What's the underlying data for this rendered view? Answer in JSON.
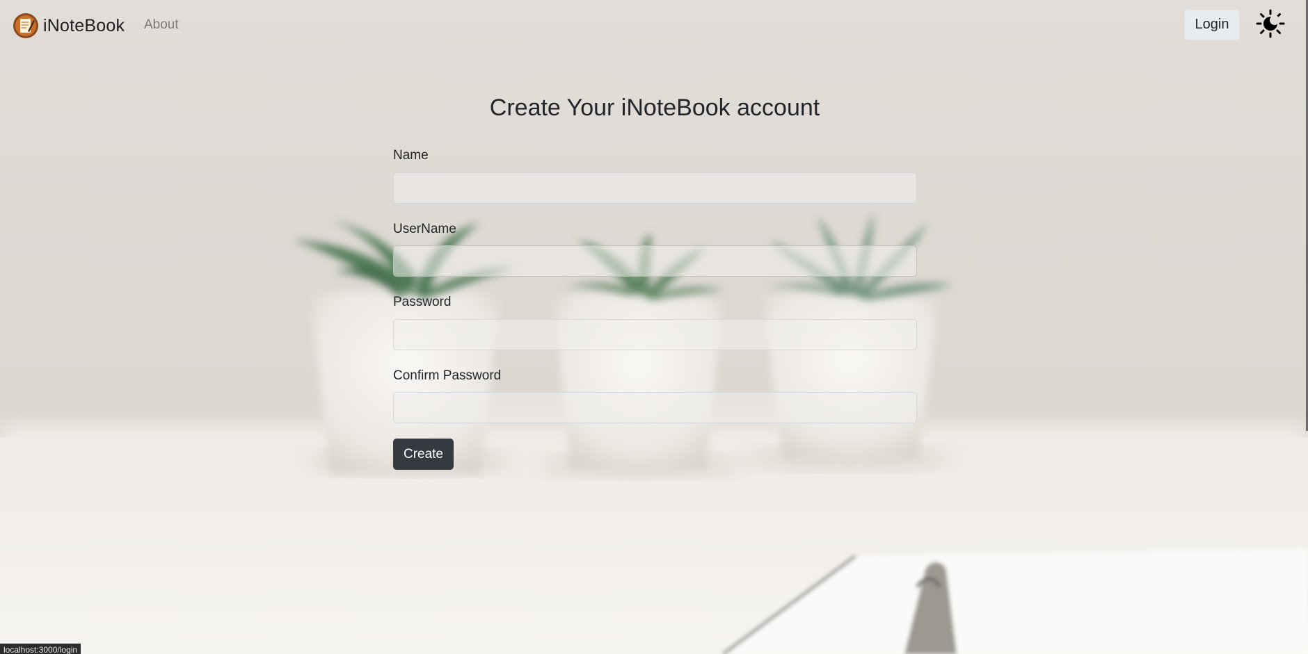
{
  "navbar": {
    "brand_name": "iNoteBook",
    "about_label": "About",
    "login_label": "Login",
    "theme_icon": "sun-moon-icon"
  },
  "form": {
    "title": "Create Your iNoteBook account",
    "fields": [
      {
        "label": "Name",
        "value": "",
        "type": "text"
      },
      {
        "label": "UserName",
        "value": "",
        "type": "text"
      },
      {
        "label": "Password",
        "value": "",
        "type": "password"
      },
      {
        "label": "Confirm Password",
        "value": "",
        "type": "password"
      }
    ],
    "submit_label": "Create"
  },
  "status_bar": {
    "url": "localhost:3000/login"
  },
  "colors": {
    "primary_button": "#343a40",
    "login_button": "#e9ecef",
    "background": "#e4e0dc"
  }
}
